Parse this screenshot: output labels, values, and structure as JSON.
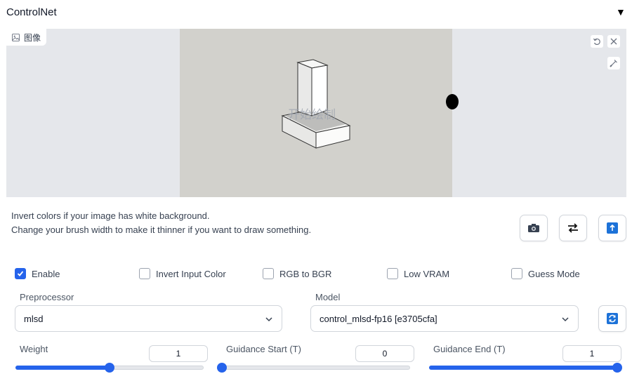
{
  "header": {
    "title": "ControlNet",
    "toggle_icon": "triangle-down-icon"
  },
  "canvas": {
    "image_label": "图像",
    "overlay_text": "开始绘制",
    "tools": [
      "undo-icon",
      "close-icon",
      "brush-icon"
    ]
  },
  "help": {
    "line1": "Invert colors if your image has white background.",
    "line2": "Change your brush width to make it thinner if you want to draw something."
  },
  "actions": [
    "camera-icon",
    "swap-icon",
    "upload-icon"
  ],
  "checkboxes": [
    {
      "label": "Enable",
      "checked": true
    },
    {
      "label": "Invert Input Color",
      "checked": false
    },
    {
      "label": "RGB to BGR",
      "checked": false
    },
    {
      "label": "Low VRAM",
      "checked": false
    },
    {
      "label": "Guess Mode",
      "checked": false
    }
  ],
  "preprocessor": {
    "label": "Preprocessor",
    "value": "mlsd"
  },
  "model": {
    "label": "Model",
    "value": "control_mlsd-fp16 [e3705cfa]",
    "refresh_icon": "refresh-icon"
  },
  "sliders": [
    {
      "label": "Weight",
      "value": "1",
      "fraction": 0.5
    },
    {
      "label": "Guidance Start (T)",
      "value": "0",
      "fraction": 0.0
    },
    {
      "label": "Guidance End (T)",
      "value": "1",
      "fraction": 1.0
    }
  ],
  "colors": {
    "accent": "#2563eb",
    "canvas_bg": "#e5e7eb",
    "photo_bg": "#d2d1cc"
  }
}
